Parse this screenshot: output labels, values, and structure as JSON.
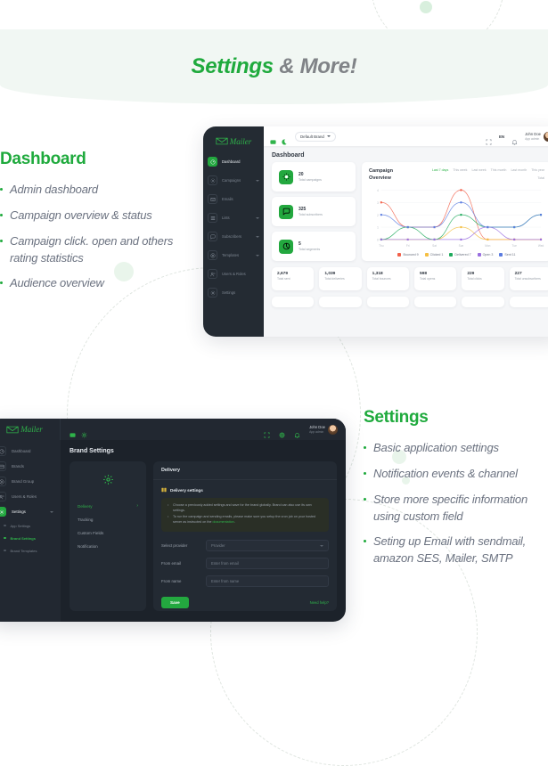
{
  "hero": {
    "accent": "Settings",
    "muted": "& More!"
  },
  "blocks": {
    "dashboard": {
      "title": "Dashboard",
      "items": [
        "Admin dashboard",
        "Campaign overview & status",
        "Campaign click. open and others rating statistics",
        "Audience overview"
      ]
    },
    "settings": {
      "title": "Settings",
      "items": [
        "Basic application settings",
        "Notification events & channel",
        "Store more specific information using custom field",
        "Seting up Email with sendmail, amazon SES, Mailer, SMTP"
      ]
    }
  },
  "colors": {
    "brand_green": "#23a83f",
    "accent_green": "#2fb34a",
    "dark_bg": "#1c222a",
    "dark_panel": "#232a33"
  },
  "dashboard_shot": {
    "logo_text": "Mailer",
    "sidebar": [
      {
        "label": "Dashboard",
        "icon": "gauge-icon",
        "active": true,
        "caret": false
      },
      {
        "label": "Campaigns",
        "icon": "megaphone-icon",
        "active": false,
        "caret": true
      },
      {
        "label": "Emails",
        "icon": "envelope-icon",
        "active": false,
        "caret": false
      },
      {
        "label": "Lists",
        "icon": "list-icon",
        "active": false,
        "caret": true
      },
      {
        "label": "Subscribers",
        "icon": "chat-icon",
        "active": false,
        "caret": true
      },
      {
        "label": "Templates",
        "icon": "layers-icon",
        "active": false,
        "caret": true
      },
      {
        "label": "Users & Roles",
        "icon": "users-icon",
        "active": false,
        "caret": false
      },
      {
        "label": "Settings",
        "icon": "gear-icon",
        "active": false,
        "caret": false
      }
    ],
    "topbar": {
      "brand_select": "Default Brand",
      "language": "EN",
      "user_name": "John Doe",
      "user_role": "App admin"
    },
    "page_title": "Dashboard",
    "stat_cards": [
      {
        "value": "20",
        "label": "Total campaigns",
        "icon": "megaphone-icon"
      },
      {
        "value": "325",
        "label": "Total subscribers",
        "icon": "chat-icon"
      },
      {
        "value": "5",
        "label": "Total segments",
        "icon": "segment-icon"
      }
    ],
    "mini_stats": [
      {
        "value": "2,679",
        "label": "Total sent"
      },
      {
        "value": "1,039",
        "label": "Total deliveries"
      },
      {
        "value": "1,318",
        "label": "Total bounces"
      },
      {
        "value": "598",
        "label": "Total opens"
      },
      {
        "value": "229",
        "label": "Total clicks"
      },
      {
        "value": "227",
        "label": "Total unsubscribers"
      }
    ]
  },
  "chart_data": {
    "type": "line",
    "title": "Campaign Overview",
    "tabs": [
      "Last 7 days",
      "This week",
      "Last week",
      "This month",
      "Last month",
      "This year",
      "Total"
    ],
    "active_tab": "Last 7 days",
    "categories": [
      "Thu",
      "Fri",
      "Sat",
      "Sun",
      "Mon",
      "Tue",
      "Wed"
    ],
    "x": [
      "Thu",
      "Fri",
      "Sat",
      "Sun",
      "Mon",
      "Tue",
      "Wed"
    ],
    "ylim": [
      0,
      4
    ],
    "yticks": [
      0,
      1,
      2,
      3,
      4
    ],
    "xlabel": "",
    "ylabel": "",
    "grid": true,
    "legend_position": "bottom",
    "series": [
      {
        "name": "Bounced",
        "total": 9,
        "color": "#f2604a",
        "values": [
          3,
          1,
          1,
          4,
          0,
          0,
          0
        ]
      },
      {
        "name": "Clicked",
        "total": 1,
        "color": "#f5bf42",
        "values": [
          0,
          0,
          0,
          1,
          0,
          0,
          0
        ]
      },
      {
        "name": "Delivered",
        "total": 7,
        "color": "#1faa5c",
        "values": [
          0,
          1,
          0,
          2,
          1,
          1,
          2
        ]
      },
      {
        "name": "Open",
        "total": 3,
        "color": "#9a6fe0",
        "values": [
          0,
          0,
          0,
          0,
          1,
          0,
          0
        ]
      },
      {
        "name": "Sent",
        "total": 11,
        "color": "#5b7ce0",
        "values": [
          2,
          1,
          1,
          3,
          1,
          1,
          2
        ]
      }
    ]
  },
  "settings_shot": {
    "logo_text": "Mailer",
    "topbar": {
      "user_name": "John Doe",
      "user_role": "App admin"
    },
    "sidebar": [
      {
        "label": "Dashboard",
        "icon": "gauge-icon",
        "active": false,
        "caret": false
      },
      {
        "label": "Brands",
        "icon": "card-icon",
        "active": false,
        "caret": false
      },
      {
        "label": "Brand Group",
        "icon": "group-icon",
        "active": false,
        "caret": false
      },
      {
        "label": "Users & Roles",
        "icon": "users-icon",
        "active": false,
        "caret": false
      },
      {
        "label": "Settings",
        "icon": "gear-icon",
        "active": true,
        "caret": true
      }
    ],
    "sub_items": [
      {
        "label": "App Settings",
        "active": false
      },
      {
        "label": "Brand Settings",
        "active": true
      },
      {
        "label": "Brand Templates",
        "active": false
      }
    ],
    "page_title": "Brand Settings",
    "nav_links": [
      {
        "label": "Delivery",
        "active": true,
        "chevron": "›"
      },
      {
        "label": "Tracking",
        "active": false,
        "chevron": ""
      },
      {
        "label": "Custom Fields",
        "active": false,
        "chevron": ""
      },
      {
        "label": "Notification",
        "active": false,
        "chevron": ""
      }
    ],
    "panel": {
      "head": "Delivery",
      "section_title": "Delivery settings",
      "notes": [
        "Choose a previously added settings and save for the brand globally. Brand can also use its own settings.",
        "To run the campaign and sending emails, please make sure you setup the cron job on your hosted server as instructed on the documentation."
      ],
      "note_link": "documentation",
      "fields": [
        {
          "label": "Select provider",
          "value": "Provider",
          "type": "select"
        },
        {
          "label": "From email",
          "value": "Enter from email",
          "type": "text"
        },
        {
          "label": "From name",
          "value": "Enter from name",
          "type": "text"
        }
      ],
      "save_label": "Save",
      "help_label": "Need help?"
    }
  }
}
